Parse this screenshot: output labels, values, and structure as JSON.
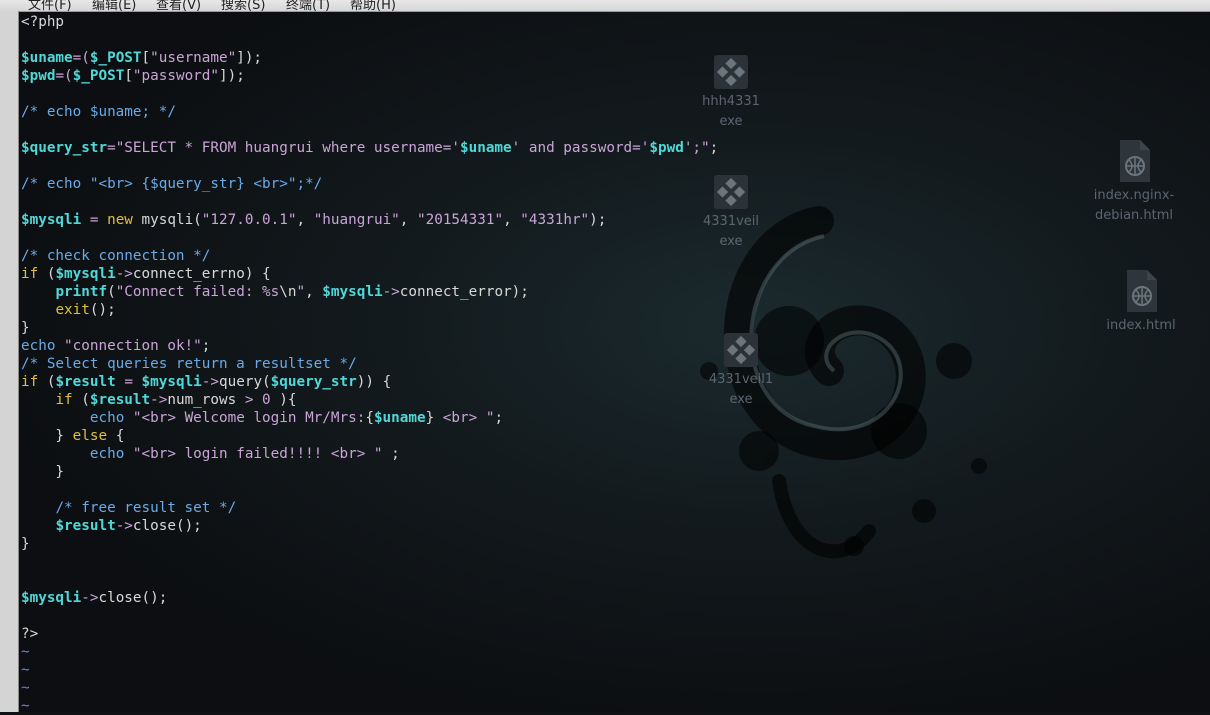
{
  "menubar": {
    "items": [
      "文件(F)",
      "编辑(E)",
      "查看(V)",
      "搜索(S)",
      "终端(T)",
      "帮助(H)"
    ]
  },
  "desktop": {
    "icons": [
      {
        "name": "hhh4331.exe",
        "line1": "hhh4331",
        "line2": "exe",
        "type": "exe-icon"
      },
      {
        "name": "4331veil.exe",
        "line1": "4331veil",
        "line2": "exe",
        "type": "exe-icon"
      },
      {
        "name": "4331veil1.exe",
        "line1": "4331veil1",
        "line2": "exe",
        "type": "exe-icon"
      },
      {
        "name": "index.nginx-debian.html",
        "line1": "index.nginx-",
        "line2": "debian.html",
        "type": "html-icon"
      },
      {
        "name": "index.html",
        "line1": "index.html",
        "line2": "",
        "type": "html-icon"
      }
    ]
  },
  "editor": {
    "lines": [
      [
        [
          "c-plain",
          "<?php"
        ]
      ],
      [],
      [
        [
          "c-var",
          "$uname"
        ],
        [
          "c-op",
          "=("
        ],
        [
          "c-var",
          "$_POST"
        ],
        [
          "c-plain",
          "["
        ],
        [
          "c-string",
          "\"username\""
        ],
        [
          "c-plain",
          "]);"
        ]
      ],
      [
        [
          "c-var",
          "$pwd"
        ],
        [
          "c-op",
          "=("
        ],
        [
          "c-var",
          "$_POST"
        ],
        [
          "c-plain",
          "["
        ],
        [
          "c-string",
          "\"password\""
        ],
        [
          "c-plain",
          "]);"
        ]
      ],
      [],
      [
        [
          "c-comment",
          "/* echo $uname; */"
        ]
      ],
      [],
      [
        [
          "c-var",
          "$query_str"
        ],
        [
          "c-op",
          "="
        ],
        [
          "c-string",
          "\"SELECT * FROM huangrui where username='"
        ],
        [
          "c-var",
          "$uname"
        ],
        [
          "c-string",
          "' and password='"
        ],
        [
          "c-var",
          "$pwd"
        ],
        [
          "c-string",
          "';\""
        ],
        [
          "c-plain",
          ";"
        ]
      ],
      [],
      [
        [
          "c-comment",
          "/* echo \"<br> {$query_str} <br>\";*/"
        ]
      ],
      [],
      [
        [
          "c-var",
          "$mysqli"
        ],
        [
          "c-plain",
          " "
        ],
        [
          "c-op",
          "="
        ],
        [
          "c-plain",
          " "
        ],
        [
          "c-key",
          "new"
        ],
        [
          "c-plain",
          " mysqli("
        ],
        [
          "c-string",
          "\"127.0.0.1\""
        ],
        [
          "c-plain",
          ", "
        ],
        [
          "c-string",
          "\"huangrui\""
        ],
        [
          "c-plain",
          ", "
        ],
        [
          "c-string",
          "\"20154331\""
        ],
        [
          "c-plain",
          ", "
        ],
        [
          "c-string",
          "\"4331hr\""
        ],
        [
          "c-plain",
          ");"
        ]
      ],
      [],
      [
        [
          "c-comment",
          "/* check connection */"
        ]
      ],
      [
        [
          "c-key",
          "if"
        ],
        [
          "c-plain",
          " ("
        ],
        [
          "c-var",
          "$mysqli"
        ],
        [
          "c-op",
          "->"
        ],
        [
          "c-plain",
          "connect_errno) {"
        ]
      ],
      [
        [
          "c-plain",
          "    "
        ],
        [
          "c-var",
          "printf"
        ],
        [
          "c-plain",
          "("
        ],
        [
          "c-string",
          "\"Connect failed: %s"
        ],
        [
          "c-plain",
          "\\n"
        ],
        [
          "c-string",
          "\""
        ],
        [
          "c-plain",
          ", "
        ],
        [
          "c-var",
          "$mysqli"
        ],
        [
          "c-op",
          "->"
        ],
        [
          "c-plain",
          "connect_error);"
        ]
      ],
      [
        [
          "c-plain",
          "    "
        ],
        [
          "c-key",
          "exit"
        ],
        [
          "c-plain",
          "();"
        ]
      ],
      [
        [
          "c-plain",
          "}"
        ]
      ],
      [
        [
          "c-comment",
          "echo"
        ],
        [
          "c-plain",
          " "
        ],
        [
          "c-string",
          "\"connection ok!\""
        ],
        [
          "c-plain",
          ";"
        ]
      ],
      [
        [
          "c-comment",
          "/* Select queries return a resultset */"
        ]
      ],
      [
        [
          "c-key",
          "if"
        ],
        [
          "c-plain",
          " ("
        ],
        [
          "c-var",
          "$result"
        ],
        [
          "c-plain",
          " "
        ],
        [
          "c-op",
          "="
        ],
        [
          "c-plain",
          " "
        ],
        [
          "c-var",
          "$mysqli"
        ],
        [
          "c-op",
          "->"
        ],
        [
          "c-plain",
          "query("
        ],
        [
          "c-var",
          "$query_str"
        ],
        [
          "c-plain",
          ")) {"
        ]
      ],
      [
        [
          "c-plain",
          "    "
        ],
        [
          "c-key",
          "if"
        ],
        [
          "c-plain",
          " ("
        ],
        [
          "c-var",
          "$result"
        ],
        [
          "c-op",
          "->"
        ],
        [
          "c-plain",
          "num_rows "
        ],
        [
          "c-op",
          ">"
        ],
        [
          "c-plain",
          " "
        ],
        [
          "c-string",
          "0"
        ],
        [
          "c-plain",
          " ){"
        ]
      ],
      [
        [
          "c-plain",
          "        "
        ],
        [
          "c-comment",
          "echo"
        ],
        [
          "c-plain",
          " "
        ],
        [
          "c-string",
          "\"<br> Welcome login Mr/Mrs:"
        ],
        [
          "c-plain",
          "{"
        ],
        [
          "c-var",
          "$uname"
        ],
        [
          "c-plain",
          "}"
        ],
        [
          "c-string",
          " <br> \""
        ],
        [
          "c-plain",
          ";"
        ]
      ],
      [
        [
          "c-plain",
          "    } "
        ],
        [
          "c-key",
          "else"
        ],
        [
          "c-plain",
          " {"
        ]
      ],
      [
        [
          "c-plain",
          "        "
        ],
        [
          "c-comment",
          "echo"
        ],
        [
          "c-plain",
          " "
        ],
        [
          "c-string",
          "\"<br> login failed!!!! <br> \""
        ],
        [
          "c-plain",
          " ;"
        ]
      ],
      [
        [
          "c-plain",
          "    }"
        ]
      ],
      [],
      [
        [
          "c-plain",
          "    "
        ],
        [
          "c-comment",
          "/* free result set */"
        ]
      ],
      [
        [
          "c-plain",
          "    "
        ],
        [
          "c-var",
          "$result"
        ],
        [
          "c-op",
          "->"
        ],
        [
          "c-plain",
          "close();"
        ]
      ],
      [
        [
          "c-plain",
          "}"
        ]
      ],
      [],
      [],
      [
        [
          "c-var",
          "$mysqli"
        ],
        [
          "c-op",
          "->"
        ],
        [
          "c-plain",
          "close();"
        ]
      ],
      [],
      [
        [
          "c-plain",
          "?>"
        ]
      ],
      [
        [
          "c-tilde",
          "~"
        ]
      ],
      [
        [
          "c-tilde",
          "~"
        ]
      ],
      [
        [
          "c-tilde",
          "~"
        ]
      ],
      [
        [
          "c-tilde",
          "~"
        ]
      ]
    ]
  }
}
